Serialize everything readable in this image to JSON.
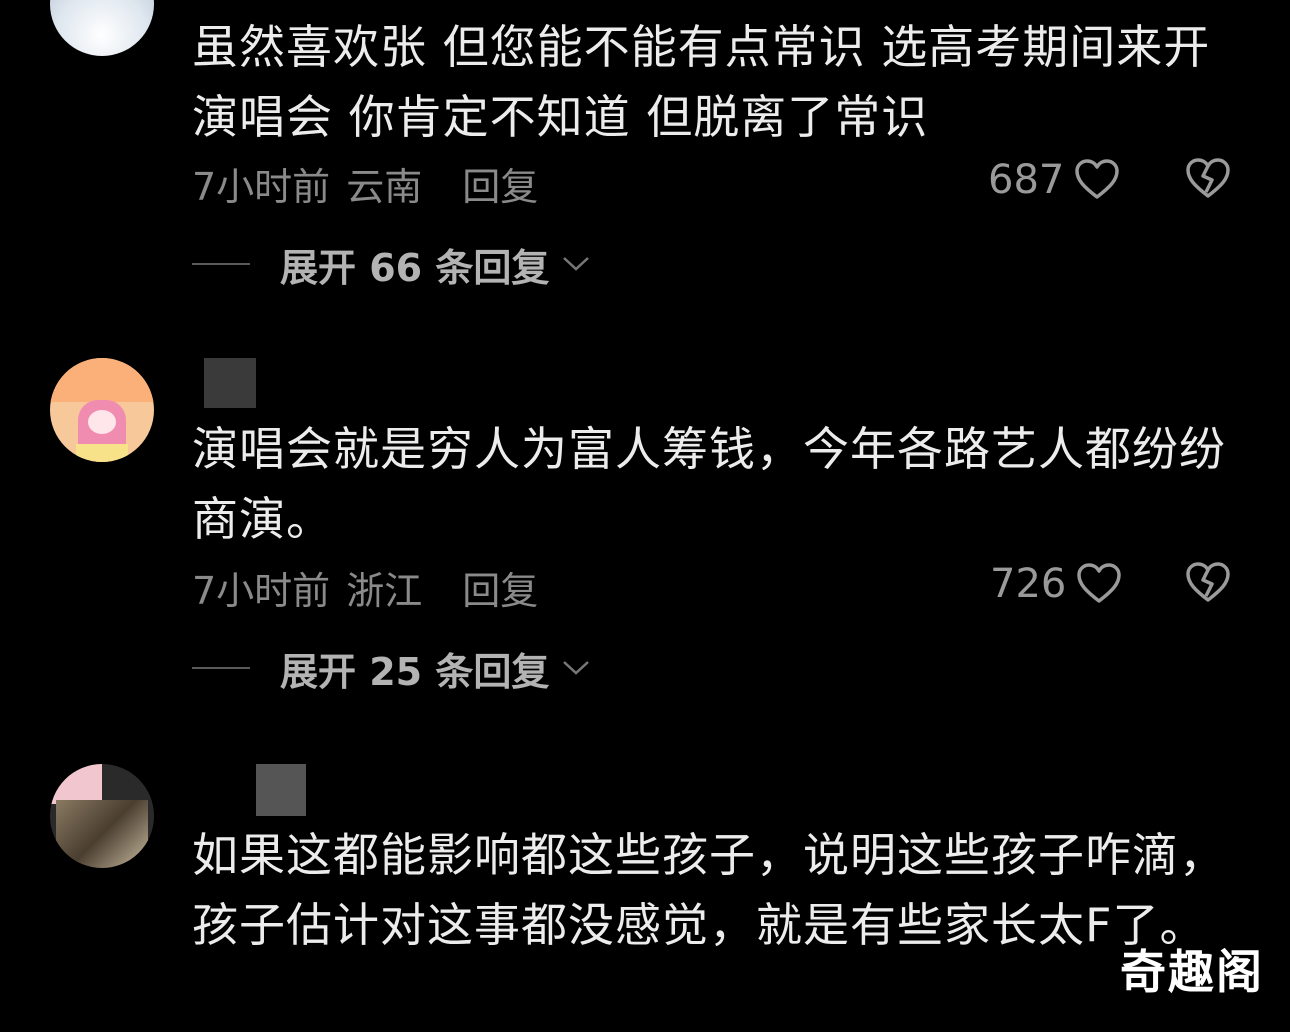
{
  "comments": [
    {
      "text": "虽然喜欢张 但您能不能有点常识 选高考期间来开演唱会 你肯定不知道 但脱离了常识",
      "time": "7小时前",
      "location": "云南",
      "reply_label": "回复",
      "likes": "687",
      "expand_label": "展开 66 条回复"
    },
    {
      "text": "演唱会就是穷人为富人筹钱，今年各路艺人都纷纷商演。",
      "time": "7小时前",
      "location": "浙江",
      "reply_label": "回复",
      "likes": "726",
      "expand_label": "展开 25 条回复"
    },
    {
      "text": "如果这都能影响都这些孩子，说明这些孩子咋滴，孩子估计对这事都没感觉，就是有些家长太F了。"
    }
  ],
  "icons": {
    "like": "heart-outline-icon",
    "dislike": "broken-heart-icon",
    "expand": "chevron-down-icon"
  },
  "watermark": "奇趣阁",
  "colors": {
    "background": "#000000",
    "text": "#ececec",
    "meta": "#8a8a8a"
  }
}
